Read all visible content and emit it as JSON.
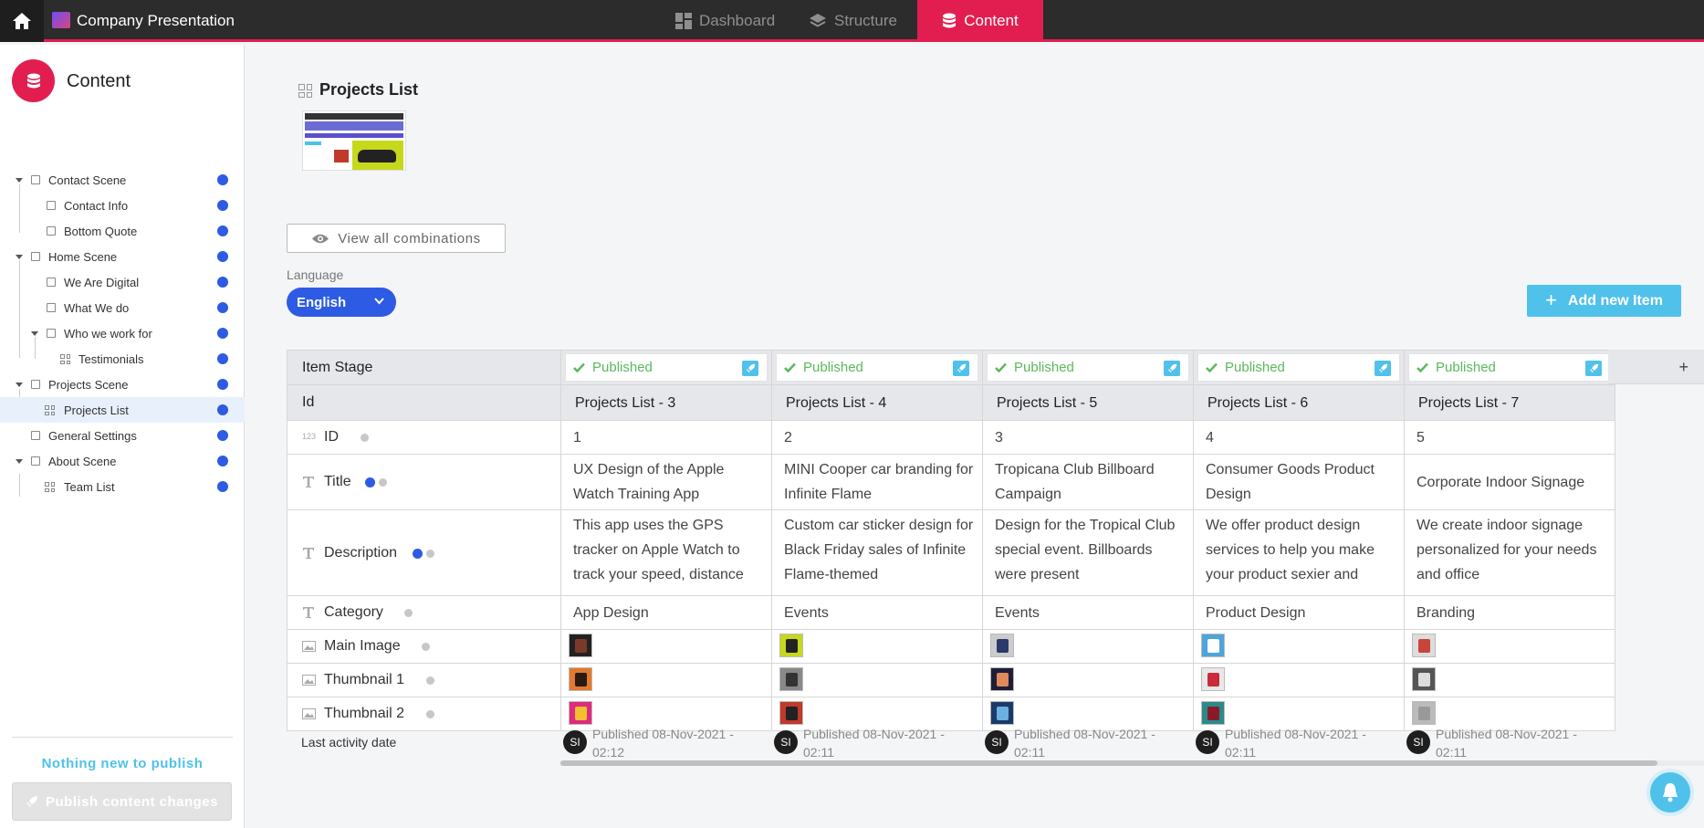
{
  "app": {
    "title": "Company Presentation"
  },
  "topnav": {
    "dashboard": "Dashboard",
    "structure": "Structure",
    "content": "Content"
  },
  "sidebar": {
    "title": "Content",
    "items": [
      {
        "label": "Contact Scene"
      },
      {
        "label": "Contact Info"
      },
      {
        "label": "Bottom Quote"
      },
      {
        "label": "Home Scene"
      },
      {
        "label": "We Are Digital"
      },
      {
        "label": "What We do"
      },
      {
        "label": "Who we work for"
      },
      {
        "label": "Testimonials"
      },
      {
        "label": "Projects Scene"
      },
      {
        "label": "Projects List"
      },
      {
        "label": "General Settings"
      },
      {
        "label": "About Scene"
      },
      {
        "label": "Team List"
      }
    ],
    "nothing_new": "Nothing new to publish",
    "publish_button": "Publish content changes"
  },
  "main": {
    "title": "Projects List",
    "view_all": "View all combinations",
    "language_label": "Language",
    "language_value": "English",
    "add_item": "Add new Item",
    "plus_column": "+"
  },
  "table": {
    "row_labels": {
      "stage": "Item Stage",
      "id_header": "Id",
      "id": "ID",
      "title": "Title",
      "description": "Description",
      "category": "Category",
      "main_image": "Main Image",
      "thumb1": "Thumbnail 1",
      "thumb2": "Thumbnail 2",
      "last_activity": "Last activity date"
    },
    "id_type_icon": "123",
    "stage_status": "Published",
    "items": [
      {
        "header": "Projects List - 3",
        "id": "1",
        "title": "UX Design of the Apple Watch Training App",
        "description": "This app uses the GPS tracker on Apple Watch to track your speed, distance",
        "category": "App Design",
        "activity": "Published 08-Nov-2021 - 02:12",
        "avatar": "SI"
      },
      {
        "header": "Projects List - 4",
        "id": "2",
        "title": "MINI Cooper car branding for Infinite Flame",
        "description": "Custom car sticker design for Black Friday sales of Infinite Flame-themed",
        "category": "Events",
        "activity": "Published 08-Nov-2021 - 02:11",
        "avatar": "SI"
      },
      {
        "header": "Projects List - 5",
        "id": "3",
        "title": "Tropicana Club Billboard Campaign",
        "description": "Design for the Tropical Club special event. Billboards were present",
        "category": "Events",
        "activity": "Published 08-Nov-2021 - 02:11",
        "avatar": "SI"
      },
      {
        "header": "Projects List - 6",
        "id": "4",
        "title": "Consumer Goods Product Design",
        "description": "We offer product design services to help you make your product sexier and",
        "category": "Product Design",
        "activity": "Published 08-Nov-2021 - 02:11",
        "avatar": "SI"
      },
      {
        "header": "Projects List - 7",
        "id": "5",
        "title": "Corporate Indoor Signage",
        "description": "We create indoor signage personalized for your needs and office",
        "category": "Branding",
        "activity": "Published 08-Nov-2021 - 02:11",
        "avatar": "SI"
      }
    ]
  },
  "colors": {
    "accent": "#e21e50",
    "primary": "#2d5be3",
    "info": "#4fc1ea",
    "success": "#5cb85c"
  }
}
